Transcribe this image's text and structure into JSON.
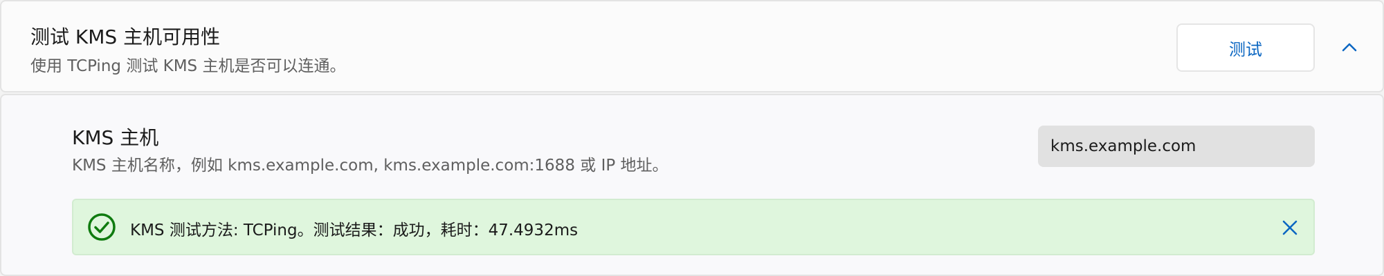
{
  "header": {
    "title": "测试 KMS 主机可用性",
    "description": "使用 TCPing 测试 KMS 主机是否可以连通。",
    "test_button_label": "测试",
    "collapse_icon": "chevron-up-icon"
  },
  "host_setting": {
    "label": "KMS 主机",
    "description": "KMS 主机名称，例如 kms.example.com, kms.example.com:1688 或 IP 地址。",
    "input_value": "kms.example.com"
  },
  "result": {
    "status": "success",
    "icon": "check-circle-icon",
    "message": "KMS 测试方法: TCPing。测试结果：成功，耗时：47.4932ms",
    "close_icon": "close-icon"
  },
  "colors": {
    "accent": "#0a66c2",
    "success": "#0f7b0f",
    "success_background": "#dff6dd",
    "input_background": "#e1e1e1"
  }
}
